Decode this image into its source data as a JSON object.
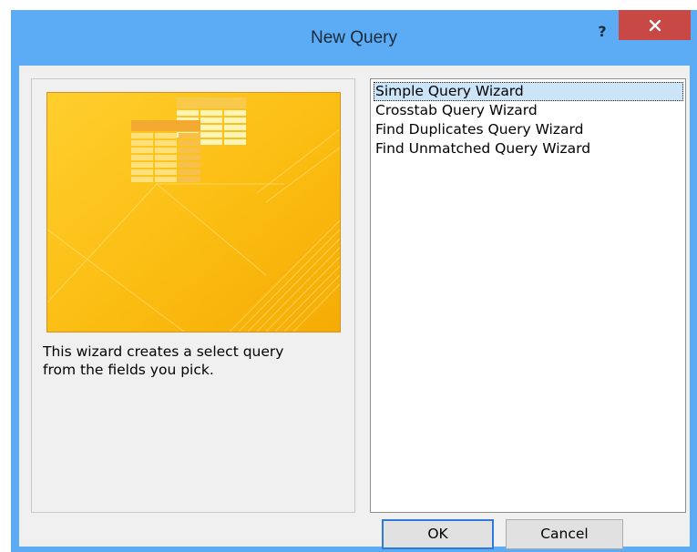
{
  "window": {
    "title": "New Query",
    "help_label": "?"
  },
  "wizard_list": {
    "items": [
      {
        "label": "Simple Query Wizard",
        "selected": true
      },
      {
        "label": "Crosstab Query Wizard",
        "selected": false
      },
      {
        "label": "Find Duplicates Query Wizard",
        "selected": false
      },
      {
        "label": "Find Unmatched Query Wizard",
        "selected": false
      }
    ]
  },
  "description": {
    "line1": "This wizard creates a select query",
    "line2": "from the fields you pick."
  },
  "buttons": {
    "ok": "OK",
    "cancel": "Cancel"
  },
  "icons": {
    "close": "close-icon",
    "help": "help-icon",
    "preview": "query-wizard-illustration"
  },
  "colors": {
    "titlebar": "#5bacf5",
    "close": "#c74845",
    "preview_gold": "#fbbd12",
    "selection": "#cce4f7"
  }
}
